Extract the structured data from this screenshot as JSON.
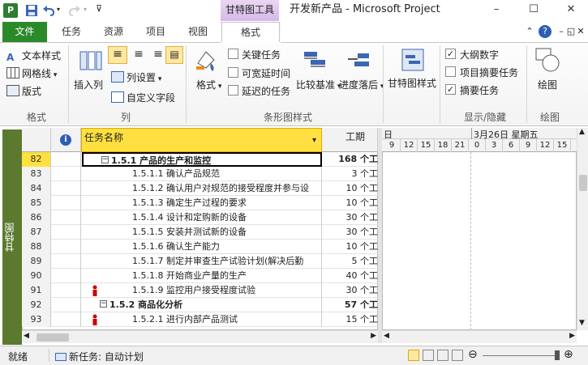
{
  "window": {
    "app_logo": "P",
    "title": "开发新产品 - Microsoft Project",
    "tool_context": "甘特图工具",
    "minimize": "–",
    "maximize": "☐",
    "close": "✕"
  },
  "tabs": {
    "file": "文件",
    "task": "任务",
    "resource": "资源",
    "project": "项目",
    "view": "视图",
    "format": "格式"
  },
  "ribbon": {
    "format_group": {
      "label": "格式",
      "text_styles": "文本样式",
      "gridlines": "网格线",
      "layout": "版式"
    },
    "columns_group": {
      "label": "列",
      "insert_column": "插入列",
      "column_settings": "列设置",
      "custom_fields": "自定义字段"
    },
    "bar_styles_group": {
      "label": "条形图样式",
      "format": "格式",
      "critical_tasks": "关键任务",
      "slack": "可宽延时间",
      "late_tasks": "延迟的任务",
      "baseline": "比较基准",
      "slippage": "进度落后",
      "critical_checked": false,
      "slack_checked": false,
      "late_checked": false
    },
    "gantt_style_group": {
      "label": "",
      "gantt_style": "甘特图样式"
    },
    "show_hide_group": {
      "label": "显示/隐藏",
      "outline_number": "大纲数字",
      "project_summary": "项目摘要任务",
      "summary_tasks": "摘要任务",
      "outline_checked": true,
      "project_summary_checked": false,
      "summary_checked": true
    },
    "drawings_group": {
      "label": "绘图",
      "drawing": "绘图"
    }
  },
  "view_bar_label": "甘特图",
  "grid": {
    "info_header": "i",
    "name_header": "任务名称",
    "duration_header": "工期",
    "rows": [
      {
        "id": "82",
        "name": "1.5.1  产品的生产和监控",
        "duration": "168 个工",
        "summary": true,
        "indent": 2,
        "person": false
      },
      {
        "id": "83",
        "name": "1.5.1.1  确认产品规范",
        "duration": "3 个工",
        "summary": false,
        "indent": 3,
        "person": false
      },
      {
        "id": "84",
        "name": "1.5.1.2  确认用户对规范的接受程度并参与设",
        "duration": "10 个工",
        "summary": false,
        "indent": 3,
        "person": false
      },
      {
        "id": "85",
        "name": "1.5.1.3  确定生产过程的要求",
        "duration": "10 个工",
        "summary": false,
        "indent": 3,
        "person": false
      },
      {
        "id": "86",
        "name": "1.5.1.4  设计和定购新的设备",
        "duration": "30 个工",
        "summary": false,
        "indent": 3,
        "person": false
      },
      {
        "id": "87",
        "name": "1.5.1.5  安装并测试新的设备",
        "duration": "30 个工",
        "summary": false,
        "indent": 3,
        "person": false
      },
      {
        "id": "88",
        "name": "1.5.1.6  确认生产能力",
        "duration": "10 个工",
        "summary": false,
        "indent": 3,
        "person": false
      },
      {
        "id": "89",
        "name": "1.5.1.7  制定并审查生产试验计划(解决后勤",
        "duration": "5 个工",
        "summary": false,
        "indent": 3,
        "person": false
      },
      {
        "id": "90",
        "name": "1.5.1.8  开始商业产量的生产",
        "duration": "40 个工",
        "summary": false,
        "indent": 3,
        "person": false
      },
      {
        "id": "91",
        "name": "1.5.1.9  监控用户接受程度试验",
        "duration": "30 个工",
        "summary": false,
        "indent": 3,
        "person": true
      },
      {
        "id": "92",
        "name": "1.5.2  商品化分析",
        "duration": "57 个工",
        "summary": true,
        "indent": 2,
        "person": false
      },
      {
        "id": "93",
        "name": "1.5.2.1  进行内部产品测试",
        "duration": "15 个工",
        "summary": false,
        "indent": 3,
        "person": true
      }
    ]
  },
  "timescale": {
    "top_left": "日",
    "top_right": "3月26日  星期五",
    "ticks": [
      "9",
      "12",
      "15",
      "18",
      "21",
      "0",
      "3",
      "6",
      "9",
      "12",
      "15"
    ]
  },
  "status": {
    "ready": "就绪",
    "new_task_mode": "新任务: 自动计划"
  },
  "colors": {
    "file_tab": "#2a8a2a",
    "view_bar": "#5b7a2e",
    "tool_context": "#d7b8e8",
    "name_header": "#ffe040",
    "selected_row": "#000000"
  }
}
